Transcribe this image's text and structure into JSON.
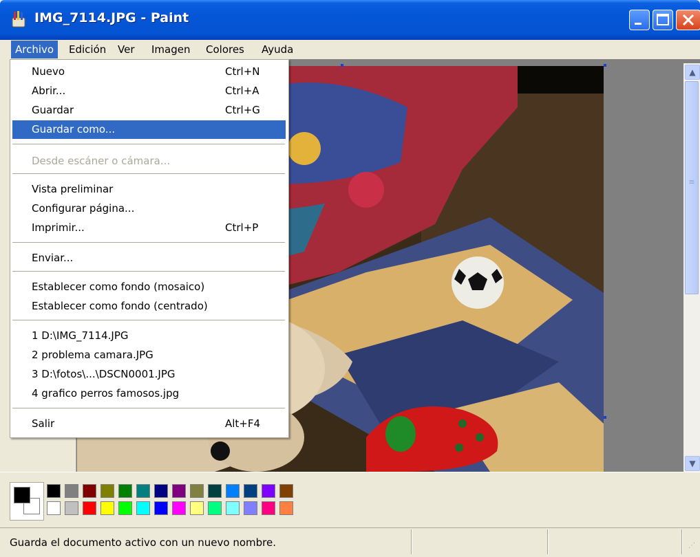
{
  "window": {
    "title": "IMG_7114.JPG - Paint",
    "icons": {
      "app": "paint-app-icon",
      "minimize": "minimize-icon",
      "maximize": "maximize-icon",
      "close": "close-icon"
    }
  },
  "menubar": {
    "items": [
      {
        "label": "Archivo",
        "active": true
      },
      {
        "label": "Edición"
      },
      {
        "label": "Ver"
      },
      {
        "label": "Imagen"
      },
      {
        "label": "Colores"
      },
      {
        "label": "Ayuda"
      }
    ]
  },
  "file_menu": {
    "items": [
      {
        "label": "Nuevo",
        "shortcut": "Ctrl+N"
      },
      {
        "label": "Abrir...",
        "shortcut": "Ctrl+A"
      },
      {
        "label": "Guardar",
        "shortcut": "Ctrl+G"
      },
      {
        "label": "Guardar como...",
        "shortcut": "",
        "highlighted": true
      },
      {
        "label": "Desde escáner o cámara...",
        "shortcut": "",
        "disabled": true
      },
      {
        "label": "Vista preliminar",
        "shortcut": ""
      },
      {
        "label": "Configurar página...",
        "shortcut": ""
      },
      {
        "label": "Imprimir...",
        "shortcut": "Ctrl+P"
      },
      {
        "label": "Enviar...",
        "shortcut": ""
      },
      {
        "label": "Establecer como fondo (mosaico)",
        "shortcut": ""
      },
      {
        "label": "Establecer como fondo (centrado)",
        "shortcut": ""
      },
      {
        "label": "1 D:\\IMG_7114.JPG",
        "shortcut": ""
      },
      {
        "label": "2 problema camara.JPG",
        "shortcut": ""
      },
      {
        "label": "3 D:\\fotos\\...\\DSCN0001.JPG",
        "shortcut": ""
      },
      {
        "label": "4 grafico perros famosos.jpg",
        "shortcut": ""
      },
      {
        "label": "Salir",
        "shortcut": "Alt+F4"
      }
    ]
  },
  "scrollbar": {
    "up_arrow": "▲",
    "down_arrow": "▼"
  },
  "palette": {
    "foreground": "#000000",
    "background": "#FFFFFF",
    "top_row": [
      "#000000",
      "#808080",
      "#800000",
      "#808000",
      "#008000",
      "#008080",
      "#000080",
      "#800080",
      "#808040",
      "#004040",
      "#0080FF",
      "#004080",
      "#8000FF",
      "#804000"
    ],
    "bottom_row": [
      "#FFFFFF",
      "#C0C0C0",
      "#FF0000",
      "#FFFF00",
      "#00FF00",
      "#00FFFF",
      "#0000FF",
      "#FF00FF",
      "#FFFF80",
      "#00FF80",
      "#80FFFF",
      "#8080FF",
      "#FF0080",
      "#FF8040"
    ]
  },
  "statusbar": {
    "text": "Guarda el documento activo con un nuevo nombre."
  }
}
